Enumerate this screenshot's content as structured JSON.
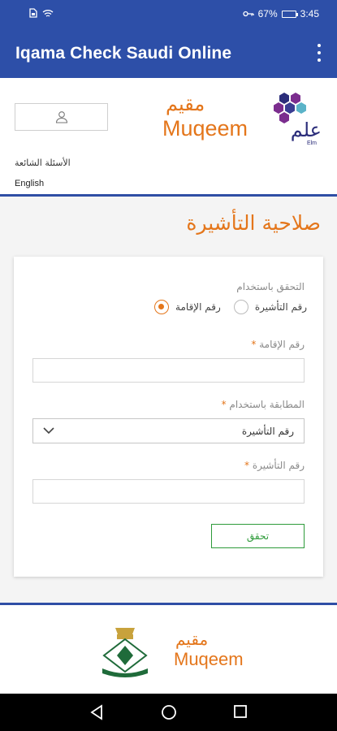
{
  "status_bar": {
    "battery": "67%",
    "time": "3:45"
  },
  "app_bar": {
    "title": "Iqama Check Saudi Online"
  },
  "header": {
    "faq_label": "الأسئلة الشائعة",
    "language_label": "English",
    "logo_ar": "مقيم",
    "logo_en": "Muqeem",
    "elm_ar": "علم",
    "elm_en": "Elm"
  },
  "page": {
    "title": "صلاحية التأشيرة",
    "verify_by_label": "التحقق باستخدام",
    "radio_options": [
      {
        "label": "رقم الإقامة",
        "selected": true
      },
      {
        "label": "رقم التأشيرة",
        "selected": false
      }
    ],
    "iqama_label": "رقم الإقامة",
    "match_label": "المطابقة باستخدام",
    "match_selected": "رقم التأشيرة",
    "visa_label": "رقم التأشيرة",
    "submit_label": "تحقق",
    "accent_color": "#e4761b",
    "brand_color": "#2d4fa8",
    "button_color": "#2e9b3a"
  },
  "footer": {
    "logo_ar": "مقيم",
    "logo_en": "Muqeem"
  }
}
